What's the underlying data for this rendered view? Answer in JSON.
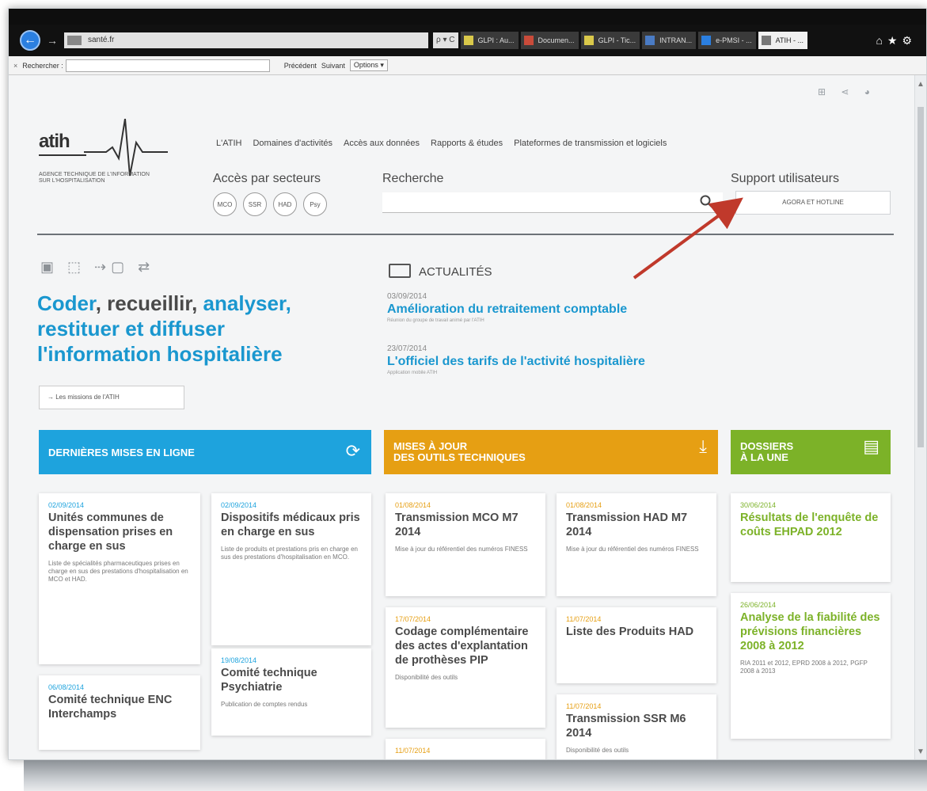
{
  "browser": {
    "address": "santé.fr",
    "address_controls": "ρ ▾ C",
    "tabs": [
      "GLPI : Au...",
      "Documen...",
      "GLPI - Tic...",
      "INTRAN...",
      "e-PMSI - ...",
      "ATIH - ..."
    ],
    "find_label": "Rechercher :",
    "find_prev": "Précédent",
    "find_next": "Suivant",
    "find_options": "Options ▾",
    "close": "×"
  },
  "site": {
    "logo": "atih",
    "tagline": "Agence technique de l'information sur l'hospitalisation",
    "nav": [
      "L'ATIH",
      "Domaines d'activités",
      "Accès aux données",
      "Rapports & études",
      "Plateformes de transmission et logiciels"
    ],
    "sectors_title": "Accès par secteurs",
    "sectors": [
      "MCO",
      "SSR",
      "HAD",
      "Psy"
    ],
    "search_title": "Recherche",
    "support_title": "Support utilisateurs",
    "support_button": "AGORA ET HOTLINE",
    "headline": {
      "p1": "Coder",
      "p2": ", recueillir, ",
      "p3": "analyser,",
      "p4": "restituer et diffuser",
      "p5": "l'information hospitalière"
    },
    "mission_button": "→  Les missions de l'ATIH",
    "actualites": {
      "title": "ACTUALITÉS",
      "items": [
        {
          "date": "03/09/2014",
          "title": "Amélioration du retraitement comptable",
          "sub": "Réunion du groupe de travail animé par l'ATIH"
        },
        {
          "date": "23/07/2014",
          "title": "L'officiel des tarifs de l'activité hospitalière",
          "sub": "Application mobile ATIH"
        }
      ]
    }
  },
  "columns": {
    "blue_title": "DERNIÈRES MISES EN LIGNE",
    "orange_title_1": "MISES À JOUR",
    "orange_title_2": "DES OUTILS TECHNIQUES",
    "green_title_1": "DOSSIERS",
    "green_title_2": "À LA UNE",
    "blue_cards": [
      {
        "date": "02/09/2014",
        "title": "Unités communes de dispensation prises en charge en sus",
        "desc": "Liste de spécialités pharmaceutiques prises en charge en sus des prestations d'hospitalisation en MCO et HAD."
      },
      {
        "date": "02/09/2014",
        "title": "Dispositifs médicaux pris en charge en sus",
        "desc": "Liste de produits et prestations pris en charge en sus des prestations d'hospitalisation en MCO."
      },
      {
        "date": "06/08/2014",
        "title": "Comité technique ENC Interchamps",
        "desc": ""
      },
      {
        "date": "19/08/2014",
        "title": "Comité technique Psychiatrie",
        "desc": "Publication de comptes rendus"
      }
    ],
    "orange_cards": [
      {
        "date": "01/08/2014",
        "title": "Transmission MCO M7 2014",
        "desc": "Mise à jour du référentiel des numéros FINESS"
      },
      {
        "date": "01/08/2014",
        "title": "Transmission HAD M7 2014",
        "desc": "Mise à jour du référentiel des numéros FINESS"
      },
      {
        "date": "17/07/2014",
        "title": "Codage complémentaire des actes d'explantation de prothèses PIP",
        "desc": "Disponibilité des outils"
      },
      {
        "date": "11/07/2014",
        "title": "Liste des Produits HAD",
        "desc": ""
      },
      {
        "date": "11/07/2014",
        "title": "Transmission SSR M6 2014",
        "desc": "Disponibilité des outils"
      },
      {
        "date": "11/07/2014",
        "title": "",
        "desc": ""
      }
    ],
    "green_cards": [
      {
        "date": "30/06/2014",
        "title": "Résultats de l'enquête de coûts EHPAD 2012",
        "desc": ""
      },
      {
        "date": "26/06/2014",
        "title": "Analyse de la fiabilité des prévisions financières 2008 à 2012",
        "desc": "RIA 2011 et 2012, EPRD 2008 à 2012, PGFP 2008 à 2013"
      }
    ]
  },
  "colors": {
    "blue": "#1ea3dd",
    "orange": "#e69f13",
    "green": "#7cb228",
    "arrow": "#c0392b"
  }
}
